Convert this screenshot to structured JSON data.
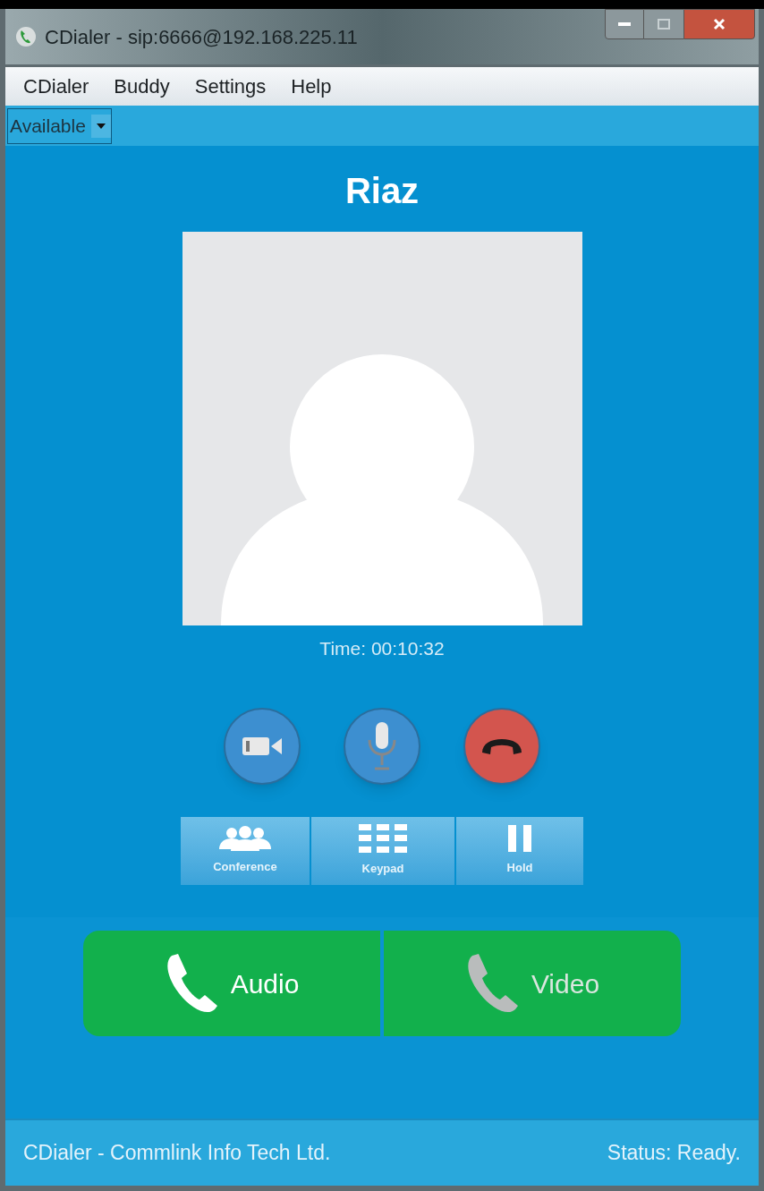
{
  "window": {
    "title": "CDialer - sip:6666@192.168.225.11"
  },
  "menu": [
    "CDialer",
    "Buddy",
    "Settings",
    "Help"
  ],
  "presence": {
    "value": "Available"
  },
  "contact": {
    "name": "Riaz",
    "call_time": "Time: 00:10:32"
  },
  "call_controls": [
    {
      "kind": "video"
    },
    {
      "kind": "mic"
    },
    {
      "kind": "hangup"
    }
  ],
  "tools": [
    {
      "kind": "conference",
      "label": "Conference"
    },
    {
      "kind": "keypad",
      "label": "Keypad"
    },
    {
      "kind": "hold",
      "label": "Hold"
    }
  ],
  "call_buttons": [
    {
      "label": "Audio",
      "disabled": false
    },
    {
      "label": "Video",
      "disabled": true
    }
  ],
  "status_bar": {
    "left": "CDialer - Commlink Info Tech Ltd.",
    "right": "Status: Ready."
  }
}
